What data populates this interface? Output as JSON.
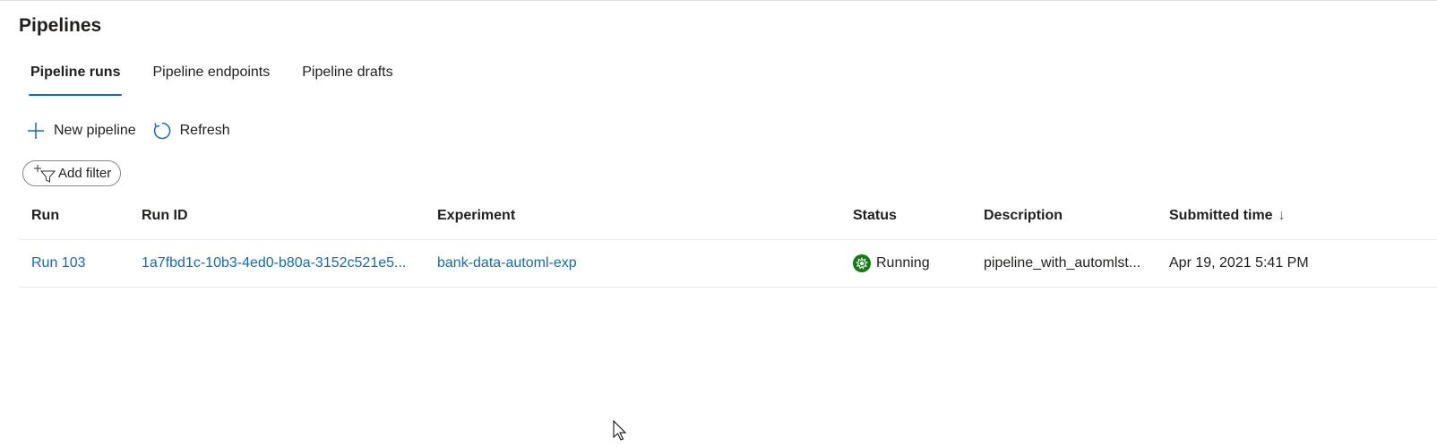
{
  "page": {
    "title": "Pipelines"
  },
  "tabs": [
    {
      "label": "Pipeline runs",
      "active": true
    },
    {
      "label": "Pipeline endpoints",
      "active": false
    },
    {
      "label": "Pipeline drafts",
      "active": false
    }
  ],
  "toolbar": {
    "new_pipeline_label": "New pipeline",
    "refresh_label": "Refresh",
    "add_filter_label": "Add filter"
  },
  "table": {
    "columns": {
      "run": "Run",
      "run_id": "Run ID",
      "experiment": "Experiment",
      "status": "Status",
      "description": "Description",
      "submitted_time": "Submitted time",
      "sort_indicator": "↓"
    },
    "rows": [
      {
        "run": "Run 103",
        "run_id": "1a7fbd1c-10b3-4ed0-b80a-3152c521e5...",
        "experiment": "bank-data-automl-exp",
        "status": "Running",
        "description": "pipeline_with_automlst...",
        "submitted_time": "Apr 19, 2021 5:41 PM"
      }
    ]
  },
  "colors": {
    "accent": "#0f6cbd",
    "status_running": "#107c10",
    "text": "#201f1e",
    "border": "#edebe9"
  }
}
